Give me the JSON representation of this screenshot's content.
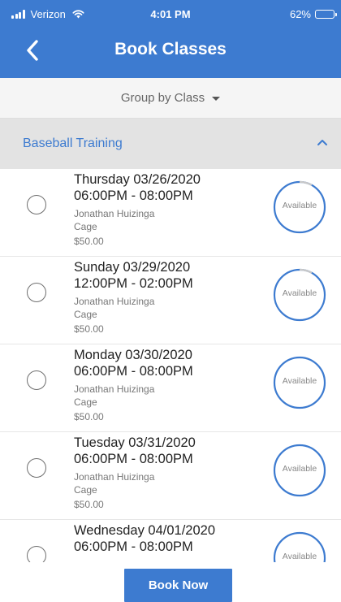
{
  "status_bar": {
    "carrier": "Verizon",
    "time": "4:01 PM",
    "battery": "62%",
    "battery_level": 0.62
  },
  "header": {
    "title": "Book Classes",
    "back_icon": "chevron-left-icon"
  },
  "group_by": {
    "label": "Group by Class",
    "icon": "caret-down-icon"
  },
  "section": {
    "title": "Baseball Training",
    "icon": "chevron-up-icon"
  },
  "classes": [
    {
      "date": "Thursday 03/26/2020",
      "time": "06:00PM - 08:00PM",
      "instructor": "Jonathan Huizinga",
      "location": "Cage",
      "price": "$50.00",
      "status": "Available",
      "booked_fraction": 0.08
    },
    {
      "date": "Sunday 03/29/2020",
      "time": "12:00PM - 02:00PM",
      "instructor": "Jonathan Huizinga",
      "location": "Cage",
      "price": "$50.00",
      "status": "Available",
      "booked_fraction": 0.08
    },
    {
      "date": "Monday 03/30/2020",
      "time": "06:00PM - 08:00PM",
      "instructor": "Jonathan Huizinga",
      "location": "Cage",
      "price": "$50.00",
      "status": "Available",
      "booked_fraction": 0
    },
    {
      "date": "Tuesday 03/31/2020",
      "time": "06:00PM - 08:00PM",
      "instructor": "Jonathan Huizinga",
      "location": "Cage",
      "price": "$50.00",
      "status": "Available",
      "booked_fraction": 0
    },
    {
      "date": "Wednesday 04/01/2020",
      "time": "06:00PM - 08:00PM",
      "instructor": "",
      "location": "",
      "price": "",
      "status": "Available",
      "booked_fraction": 0
    }
  ],
  "book_button": {
    "label": "Book Now"
  },
  "colors": {
    "primary": "#3d7bd0",
    "ring_track": "#c8c8c8"
  }
}
